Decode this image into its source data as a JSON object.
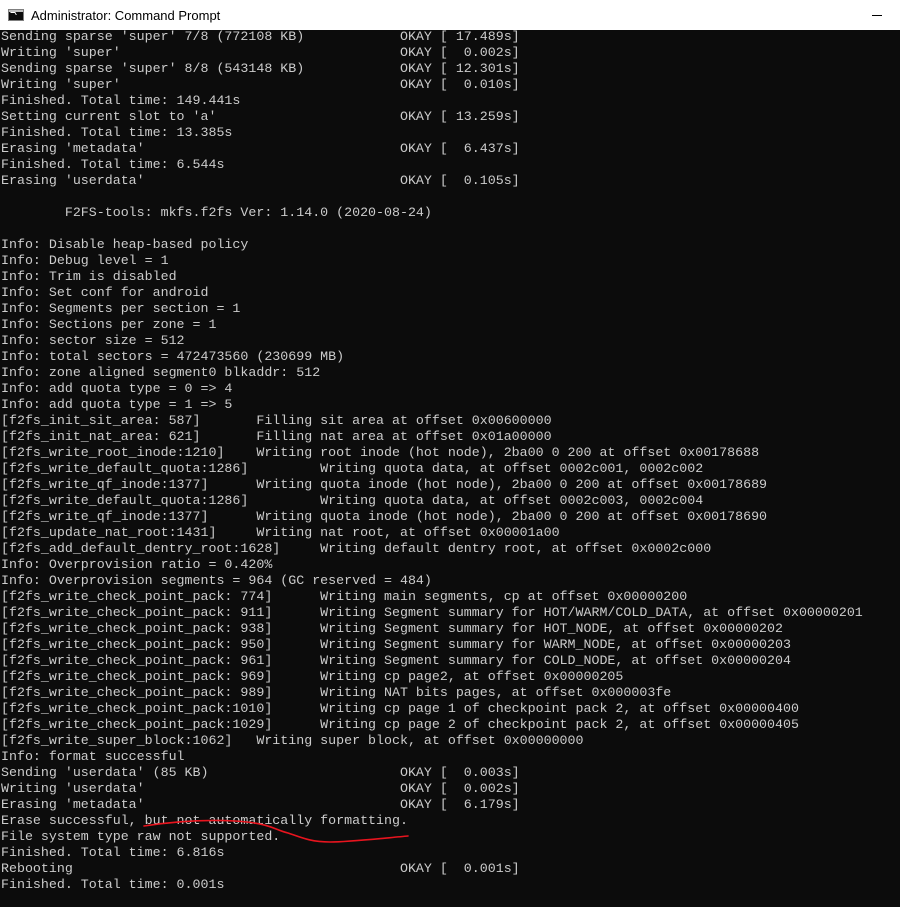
{
  "window": {
    "title": "Administrator: Command Prompt",
    "icon": "cmd-icon",
    "minimize_icon": "minimize-icon"
  },
  "console": {
    "text_color": "#cccccc",
    "background": "#0c0c0c",
    "annotation_color": "#e8141e",
    "lines": [
      "Sending sparse 'super' 7/8 (772108 KB)            OKAY [ 17.489s]",
      "Writing 'super'                                   OKAY [  0.002s]",
      "Sending sparse 'super' 8/8 (543148 KB)            OKAY [ 12.301s]",
      "Writing 'super'                                   OKAY [  0.010s]",
      "Finished. Total time: 149.441s",
      "Setting current slot to 'a'                       OKAY [ 13.259s]",
      "Finished. Total time: 13.385s",
      "Erasing 'metadata'                                OKAY [  6.437s]",
      "Finished. Total time: 6.544s",
      "Erasing 'userdata'                                OKAY [  0.105s]",
      "",
      "        F2FS-tools: mkfs.f2fs Ver: 1.14.0 (2020-08-24)",
      "",
      "Info: Disable heap-based policy",
      "Info: Debug level = 1",
      "Info: Trim is disabled",
      "Info: Set conf for android",
      "Info: Segments per section = 1",
      "Info: Sections per zone = 1",
      "Info: sector size = 512",
      "Info: total sectors = 472473560 (230699 MB)",
      "Info: zone aligned segment0 blkaddr: 512",
      "Info: add quota type = 0 => 4",
      "Info: add quota type = 1 => 5",
      "[f2fs_init_sit_area: 587]       Filling sit area at offset 0x00600000",
      "[f2fs_init_nat_area: 621]       Filling nat area at offset 0x01a00000",
      "[f2fs_write_root_inode:1210]    Writing root inode (hot node), 2ba00 0 200 at offset 0x00178688",
      "[f2fs_write_default_quota:1286]         Writing quota data, at offset 0002c001, 0002c002",
      "[f2fs_write_qf_inode:1377]      Writing quota inode (hot node), 2ba00 0 200 at offset 0x00178689",
      "[f2fs_write_default_quota:1286]         Writing quota data, at offset 0002c003, 0002c004",
      "[f2fs_write_qf_inode:1377]      Writing quota inode (hot node), 2ba00 0 200 at offset 0x00178690",
      "[f2fs_update_nat_root:1431]     Writing nat root, at offset 0x00001a00",
      "[f2fs_add_default_dentry_root:1628]     Writing default dentry root, at offset 0x0002c000",
      "Info: Overprovision ratio = 0.420%",
      "Info: Overprovision segments = 964 (GC reserved = 484)",
      "[f2fs_write_check_point_pack: 774]      Writing main segments, cp at offset 0x00000200",
      "[f2fs_write_check_point_pack: 911]      Writing Segment summary for HOT/WARM/COLD_DATA, at offset 0x00000201",
      "[f2fs_write_check_point_pack: 938]      Writing Segment summary for HOT_NODE, at offset 0x00000202",
      "[f2fs_write_check_point_pack: 950]      Writing Segment summary for WARM_NODE, at offset 0x00000203",
      "[f2fs_write_check_point_pack: 961]      Writing Segment summary for COLD_NODE, at offset 0x00000204",
      "[f2fs_write_check_point_pack: 969]      Writing cp page2, at offset 0x00000205",
      "[f2fs_write_check_point_pack: 989]      Writing NAT bits pages, at offset 0x000003fe",
      "[f2fs_write_check_point_pack:1010]      Writing cp page 1 of checkpoint pack 2, at offset 0x00000400",
      "[f2fs_write_check_point_pack:1029]      Writing cp page 2 of checkpoint pack 2, at offset 0x00000405",
      "[f2fs_write_super_block:1062]   Writing super block, at offset 0x00000000",
      "Info: format successful",
      "Sending 'userdata' (85 KB)                        OKAY [  0.003s]",
      "Writing 'userdata'                                OKAY [  0.002s]",
      "Erasing 'metadata'                                OKAY [  6.179s]",
      "Erase successful, but not automatically formatting.",
      "File system type raw not supported.",
      "Finished. Total time: 6.816s",
      "Rebooting                                         OKAY [  0.001s]",
      "Finished. Total time: 0.001s"
    ]
  }
}
